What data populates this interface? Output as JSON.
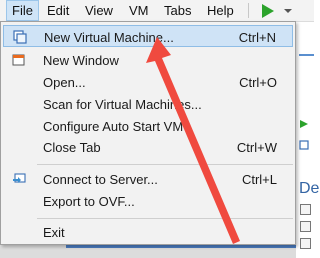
{
  "menubar": {
    "items": [
      {
        "label": "File"
      },
      {
        "label": "Edit"
      },
      {
        "label": "View"
      },
      {
        "label": "VM"
      },
      {
        "label": "Tabs"
      },
      {
        "label": "Help"
      }
    ]
  },
  "file_menu": {
    "items": [
      {
        "label": "New Virtual Machine...",
        "shortcut": "Ctrl+N",
        "icon": "new-vm-icon"
      },
      {
        "label": "New Window",
        "shortcut": "",
        "icon": "new-window-icon"
      },
      {
        "label": "Open...",
        "shortcut": "Ctrl+O"
      },
      {
        "label": "Scan for Virtual Machines..."
      },
      {
        "label": "Configure Auto Start VM"
      },
      {
        "label": "Close Tab",
        "shortcut": "Ctrl+W"
      },
      {
        "label": "Connect to Server...",
        "shortcut": "Ctrl+L",
        "icon": "connect-server-icon"
      },
      {
        "label": "Export to OVF..."
      },
      {
        "label": "Exit"
      }
    ]
  },
  "background": {
    "heading_fragment": "De"
  },
  "colors": {
    "menu_bg": "#f2f2f2",
    "highlight": "#cfe3f6",
    "play": "#2ca32c",
    "annotation_arrow": "#f04a3f"
  }
}
